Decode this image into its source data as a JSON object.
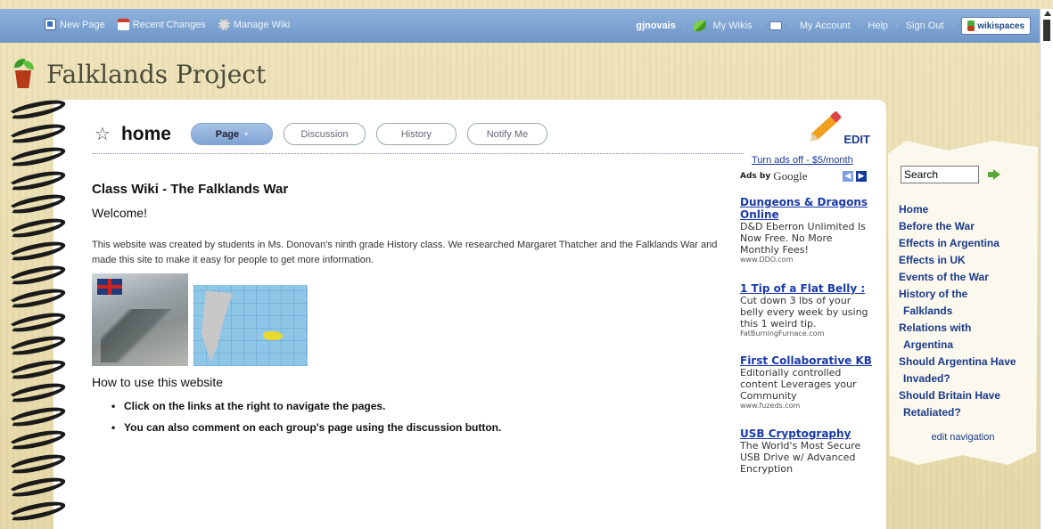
{
  "topbar": {
    "new_page": "New Page",
    "recent_changes": "Recent Changes",
    "manage_wiki": "Manage Wiki",
    "user": "gjnovais",
    "my_wikis": "My Wikis",
    "my_account": "My Account",
    "help": "Help",
    "sign_out": "Sign Out",
    "brand": "wikispaces"
  },
  "site": {
    "title": "Falklands Project"
  },
  "page": {
    "name": "home",
    "tabs": [
      "Page",
      "Discussion",
      "History",
      "Notify Me"
    ],
    "edit_label": "EDIT"
  },
  "article": {
    "heading": "Class Wiki - The Falklands War",
    "welcome": "Welcome!",
    "intro": "This website was created by students in Ms. Donovan's ninth grade History class. We researched Margaret Thatcher and the Falklands War and made this site to make it easy for people to get more information.",
    "howto": "How to use this website",
    "bullets": [
      "Click on the links at the right to navigate the pages.",
      "You can also comment on each group's page using the discussion button."
    ]
  },
  "ads": {
    "turn_off": "Turn ads off - $5/month",
    "ads_by": "Ads by",
    "google": "Google",
    "items": [
      {
        "title": "Dungeons & Dragons Online",
        "body": "D&D Eberron Unlimited Is Now Free. No More Monthly Fees!",
        "url": "www.DDO.com"
      },
      {
        "title": "1 Tip of a Flat Belly :",
        "body": "Cut down 3 lbs of your belly every week by using this 1 weird tip.",
        "url": "FatBurningFurnace.com"
      },
      {
        "title": "First Collaborative KB",
        "body": "Editorially controlled content Leverages your Community",
        "url": "www.fuzeds.com"
      },
      {
        "title": "USB Cryptography",
        "body": "The World's Most Secure USB Drive w/ Advanced Encryption",
        "url": ""
      }
    ]
  },
  "sidebar": {
    "search_value": "Search",
    "nav": [
      [
        "Home"
      ],
      [
        "Before the War"
      ],
      [
        "Effects in Argentina"
      ],
      [
        "Effects in UK"
      ],
      [
        "Events of the War"
      ],
      [
        "History of the",
        "Falklands"
      ],
      [
        "Relations with",
        "Argentina"
      ],
      [
        "Should Argentina Have",
        "Invaded?"
      ],
      [
        "Should Britain Have",
        "Retaliated?"
      ]
    ],
    "edit_navigation": "edit navigation"
  }
}
